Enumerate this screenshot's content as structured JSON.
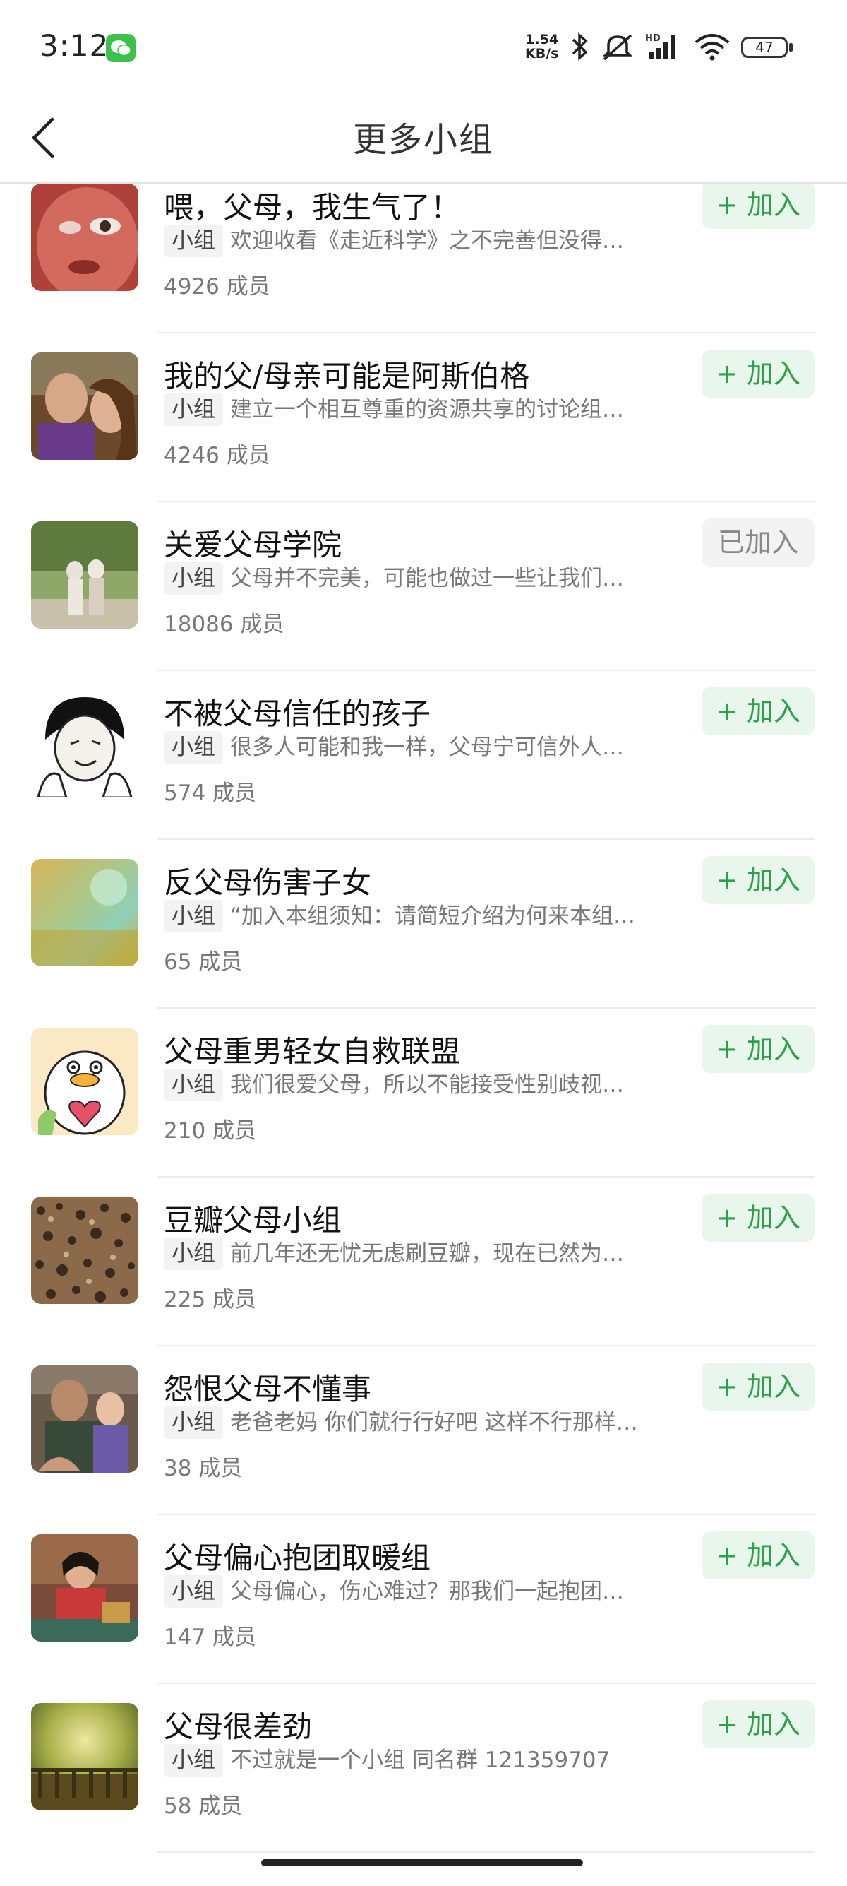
{
  "status_bar": {
    "time": "3:12",
    "net_speed_value": "1.54",
    "net_speed_unit": "KB/s",
    "battery": "47",
    "signal_label": "HD"
  },
  "nav": {
    "title": "更多小组"
  },
  "groups": [
    {
      "name": "喂，父母，我生气了！",
      "tag": "小组",
      "desc": "欢迎收看《走近科学》之不完善但没得…",
      "members": "4926 成员",
      "action": "+ 加入"
    },
    {
      "name": "我的父/母亲可能是阿斯伯格",
      "tag": "小组",
      "desc": "建立一个相互尊重的资源共享的讨论组…",
      "members": "4246 成员",
      "action": "+ 加入"
    },
    {
      "name": "关爱父母学院",
      "tag": "小组",
      "desc": "父母并不完美，可能也做过一些让我们…",
      "members": "18086 成员",
      "action": "已加入"
    },
    {
      "name": "不被父母信任的孩子",
      "tag": "小组",
      "desc": "很多人可能和我一样，父母宁可信外人…",
      "members": "574 成员",
      "action": "+ 加入"
    },
    {
      "name": "反父母伤害子女",
      "tag": "小组",
      "desc": "“加入本组须知：请简短介绍为何来本组…",
      "members": "65 成员",
      "action": "+ 加入"
    },
    {
      "name": "父母重男轻女自救联盟",
      "tag": "小组",
      "desc": "我们很爱父母，所以不能接受性别歧视…",
      "members": "210 成员",
      "action": "+ 加入"
    },
    {
      "name": "豆瓣父母小组",
      "tag": "小组",
      "desc": "前几年还无忧无虑刷豆瓣，现在已然为…",
      "members": "225 成员",
      "action": "+ 加入"
    },
    {
      "name": "怨恨父母不懂事",
      "tag": "小组",
      "desc": "老爸老妈 你们就行行好吧 这样不行那样…",
      "members": "38 成员",
      "action": "+ 加入"
    },
    {
      "name": "父母偏心抱团取暖组",
      "tag": "小组",
      "desc": "父母偏心，伤心难过？那我们一起抱团…",
      "members": "147 成员",
      "action": "+ 加入"
    },
    {
      "name": "父母很差劲",
      "tag": "小组",
      "desc": "不过就是一个小组 同名群 121359707",
      "members": "58 成员",
      "action": "+ 加入"
    }
  ]
}
